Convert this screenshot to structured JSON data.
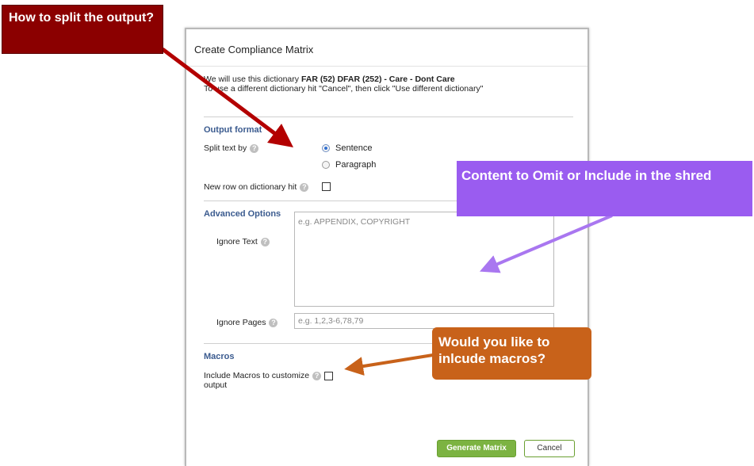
{
  "dialog": {
    "title": "Create Compliance Matrix",
    "dict_line1_prefix": "We will use this dictionary ",
    "dict_name": "FAR (52) DFAR (252) - Care - Dont Care",
    "dict_line2": "To use a different dictionary hit \"Cancel\", then click \"Use different dictionary\"",
    "output_format": {
      "heading": "Output format",
      "split_label": "Split text by",
      "options": [
        "Sentence",
        "Paragraph"
      ],
      "selected": "Sentence",
      "new_row_label": "New row on dictionary hit"
    },
    "advanced": {
      "heading": "Advanced Options",
      "ignore_text_label": "Ignore Text",
      "ignore_text_placeholder": "e.g. APPENDIX, COPYRIGHT",
      "ignore_pages_label": "Ignore Pages",
      "ignore_pages_placeholder": "e.g. 1,2,3-6,78,79"
    },
    "macros": {
      "heading": "Macros",
      "include_label_line1": "Include Macros to customize",
      "include_label_line2": "output"
    },
    "buttons": {
      "generate": "Generate Matrix",
      "cancel": "Cancel"
    }
  },
  "callouts": {
    "split": "How to split the output?",
    "omit": "Content to Omit or Include in the shred",
    "macros": "Would you like to inlcude macros?"
  },
  "colors": {
    "red_callout": "#8b0000",
    "purple_callout": "#9a5cf0",
    "orange_callout": "#c8621a",
    "generate_button": "#7cb342",
    "section_heading": "#3b5b8f"
  }
}
